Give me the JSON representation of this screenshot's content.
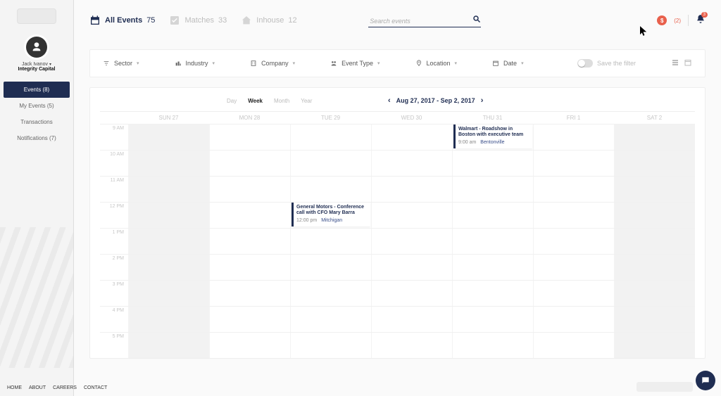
{
  "user": {
    "name": "Jack Ivanov",
    "org": "Integrity Capital"
  },
  "sidebar": {
    "items": [
      {
        "label": "Events (8)",
        "active": true
      },
      {
        "label": "My Events (5)",
        "active": false
      },
      {
        "label": "Transactions",
        "active": false
      },
      {
        "label": "Notifications (7)",
        "active": false
      }
    ]
  },
  "footer": {
    "home": "HOME",
    "about": "ABOUT",
    "careers": "CAREERS",
    "contact": "CONTACT"
  },
  "tabs": {
    "all": {
      "label": "All Events",
      "count": "75"
    },
    "matches": {
      "label": "Matches",
      "count": "33"
    },
    "inhouse": {
      "label": "Inhouse",
      "count": "12"
    }
  },
  "search": {
    "placeholder": "Search events"
  },
  "header": {
    "credits": "(2)",
    "notif_count": "3"
  },
  "filters": {
    "sector": "Sector",
    "industry": "Industry",
    "company": "Company",
    "event_type": "Event Type",
    "location": "Location",
    "date": "Date",
    "save": "Save the filter"
  },
  "calendar": {
    "modes": {
      "day": "Day",
      "week": "Week",
      "month": "Month",
      "year": "Year"
    },
    "range": "Aug 27, 2017 - Sep 2, 2017",
    "days": [
      "SUN 27",
      "MON 28",
      "TUE 29",
      "WED 30",
      "THU 31",
      "FRI 1",
      "SAT 2"
    ],
    "hours": [
      "9 AM",
      "10 AM",
      "11 AM",
      "12 PM",
      "1 PM",
      "2 PM",
      "3 PM",
      "4 PM",
      "5 PM"
    ],
    "events": [
      {
        "title": "Walmart - Roadshow in Boston with executive team",
        "time": "9:00 am",
        "location": "Bentonville"
      },
      {
        "title": "General Motors - Conference call with CFO Mary Barra",
        "time": "12:00 pm",
        "location": "Mitchigan"
      }
    ]
  }
}
